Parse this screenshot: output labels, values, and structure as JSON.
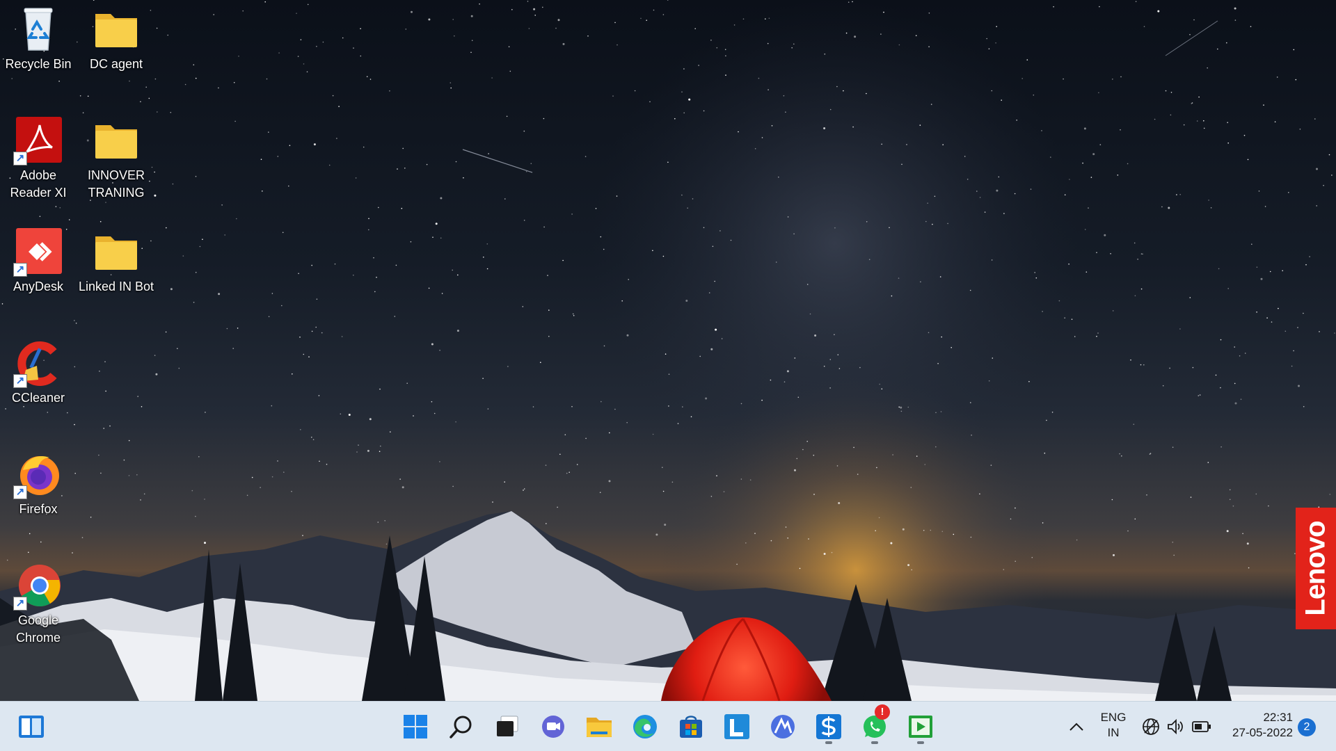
{
  "desktop": {
    "icons": [
      {
        "label": "Recycle Bin",
        "icon": "recycle-bin-icon"
      },
      {
        "label": "DC agent",
        "icon": "folder-icon"
      },
      {
        "label": "Adobe\nReader XI",
        "icon": "adobe-reader-icon"
      },
      {
        "label": "INNOVER\nTRANING",
        "icon": "folder-icon"
      },
      {
        "label": "AnyDesk",
        "icon": "anydesk-icon"
      },
      {
        "label": "Linked IN Bot",
        "icon": "folder-icon"
      },
      {
        "label": "CCleaner",
        "icon": "ccleaner-icon"
      },
      {
        "label": "Firefox",
        "icon": "firefox-icon"
      },
      {
        "label": "Google\nChrome",
        "icon": "chrome-icon"
      }
    ],
    "brand_badge": "Lenovo"
  },
  "taskbar": {
    "left_widget": "widgets-icon",
    "apps": [
      "start-icon",
      "search-icon",
      "task-view-icon",
      "teams-chat-icon",
      "file-explorer-icon",
      "edge-icon",
      "store-icon",
      "l-app-icon",
      "vpn-app-icon",
      "s-app-icon",
      "whatsapp-icon",
      "media-player-icon"
    ],
    "whatsapp_alert": "!",
    "tray": {
      "language_line1": "ENG",
      "language_line2": "IN",
      "time": "22:31",
      "date": "27-05-2022",
      "notification_count": "2"
    }
  },
  "colors": {
    "taskbar_bg": "#dde7f1",
    "lenovo_red": "#e2231a",
    "folder_yellow": "#f8c93c",
    "notification_blue": "#1a6fd1"
  }
}
